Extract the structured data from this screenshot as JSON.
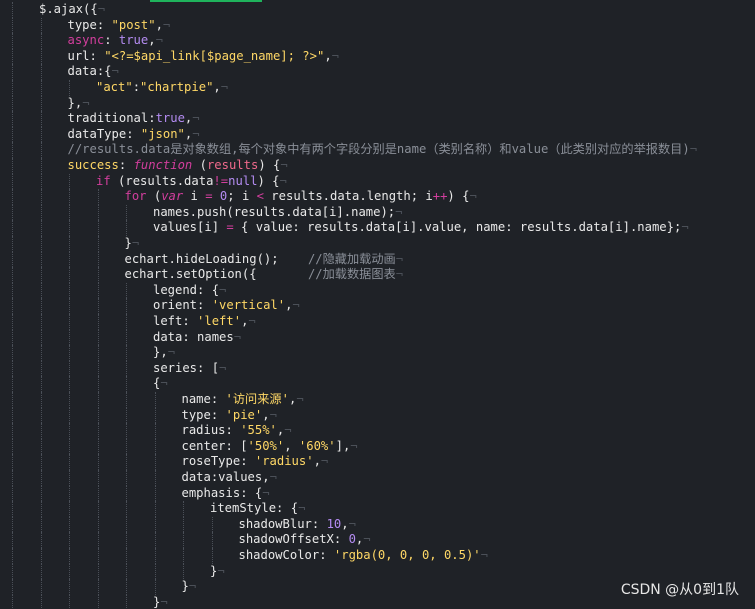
{
  "editor": {
    "lines": [
      {
        "indent": 0,
        "segments": [
          {
            "t": "$.ajax({",
            "c": "w"
          }
        ]
      },
      {
        "indent": 1,
        "segments": [
          {
            "t": "type: ",
            "c": "w"
          },
          {
            "t": "\"post\"",
            "c": "s"
          },
          {
            "t": ",",
            "c": "w"
          }
        ]
      },
      {
        "indent": 1,
        "segments": [
          {
            "t": "async",
            "c": "k"
          },
          {
            "t": ": ",
            "c": "w"
          },
          {
            "t": "true",
            "c": "n"
          },
          {
            "t": ",",
            "c": "w"
          }
        ]
      },
      {
        "indent": 1,
        "segments": [
          {
            "t": "url: ",
            "c": "w"
          },
          {
            "t": "\"<?=$api_link[$page_name]; ?>\"",
            "c": "s"
          },
          {
            "t": ",",
            "c": "w"
          }
        ]
      },
      {
        "indent": 1,
        "segments": [
          {
            "t": "data:{",
            "c": "w"
          }
        ]
      },
      {
        "indent": 2,
        "segments": [
          {
            "t": "\"act\"",
            "c": "s"
          },
          {
            "t": ":",
            "c": "w"
          },
          {
            "t": "\"chartpie\"",
            "c": "s"
          },
          {
            "t": ",",
            "c": "w"
          }
        ]
      },
      {
        "indent": 1,
        "segments": [
          {
            "t": "},",
            "c": "w"
          }
        ]
      },
      {
        "indent": 1,
        "segments": [
          {
            "t": "traditional:",
            "c": "w"
          },
          {
            "t": "true",
            "c": "n"
          },
          {
            "t": ",",
            "c": "w"
          }
        ]
      },
      {
        "indent": 1,
        "segments": [
          {
            "t": "dataType: ",
            "c": "w"
          },
          {
            "t": "\"json\"",
            "c": "s"
          },
          {
            "t": ",",
            "c": "w"
          }
        ]
      },
      {
        "indent": 1,
        "segments": [
          {
            "t": "//results.data是对象数组,每个对象中有两个字段分别是name（类别名称）和value（此类别对应的举报数目)",
            "c": "c"
          }
        ]
      },
      {
        "indent": 1,
        "segments": [
          {
            "t": "success",
            "c": "s"
          },
          {
            "t": ": ",
            "c": "w"
          },
          {
            "t": "function",
            "c": "ki"
          },
          {
            "t": " (",
            "c": "w"
          },
          {
            "t": "results",
            "c": "p"
          },
          {
            "t": ") {",
            "c": "w"
          }
        ]
      },
      {
        "indent": 2,
        "segments": [
          {
            "t": "if",
            "c": "k"
          },
          {
            "t": " (results.data",
            "c": "w"
          },
          {
            "t": "!=",
            "c": "k"
          },
          {
            "t": "null",
            "c": "n"
          },
          {
            "t": ") {",
            "c": "w"
          }
        ]
      },
      {
        "indent": 3,
        "segments": [
          {
            "t": "for",
            "c": "k"
          },
          {
            "t": " (",
            "c": "w"
          },
          {
            "t": "var",
            "c": "ki"
          },
          {
            "t": " i ",
            "c": "w"
          },
          {
            "t": "=",
            "c": "k"
          },
          {
            "t": " ",
            "c": "w"
          },
          {
            "t": "0",
            "c": "n"
          },
          {
            "t": "; i ",
            "c": "w"
          },
          {
            "t": "<",
            "c": "k"
          },
          {
            "t": " results.data.length; i",
            "c": "w"
          },
          {
            "t": "++",
            "c": "k"
          },
          {
            "t": ") {",
            "c": "w"
          }
        ]
      },
      {
        "indent": 4,
        "segments": [
          {
            "t": "names.push(results.data[i].name);",
            "c": "w"
          }
        ]
      },
      {
        "indent": 4,
        "segments": [
          {
            "t": "values[i] ",
            "c": "w"
          },
          {
            "t": "=",
            "c": "k"
          },
          {
            "t": " { value: results.data[i].value, name: results.data[i].name};",
            "c": "w"
          }
        ]
      },
      {
        "indent": 3,
        "segments": [
          {
            "t": "}",
            "c": "w"
          }
        ]
      },
      {
        "indent": 3,
        "segments": [
          {
            "t": "echart.hideLoading();    ",
            "c": "w"
          },
          {
            "t": "//隐藏加载动画",
            "c": "c"
          }
        ]
      },
      {
        "indent": 3,
        "segments": [
          {
            "t": "echart.setOption({       ",
            "c": "w"
          },
          {
            "t": "//加载数据图表",
            "c": "c"
          }
        ]
      },
      {
        "indent": 4,
        "segments": [
          {
            "t": "legend: {",
            "c": "w"
          }
        ]
      },
      {
        "indent": 4,
        "segments": [
          {
            "t": "orient: ",
            "c": "w"
          },
          {
            "t": "'vertical'",
            "c": "s"
          },
          {
            "t": ",",
            "c": "w"
          }
        ]
      },
      {
        "indent": 4,
        "segments": [
          {
            "t": "left: ",
            "c": "w"
          },
          {
            "t": "'left'",
            "c": "s"
          },
          {
            "t": ",",
            "c": "w"
          }
        ]
      },
      {
        "indent": 4,
        "segments": [
          {
            "t": "data: names",
            "c": "w"
          }
        ]
      },
      {
        "indent": 4,
        "segments": [
          {
            "t": "},",
            "c": "w"
          }
        ]
      },
      {
        "indent": 4,
        "segments": [
          {
            "t": "series: [",
            "c": "w"
          }
        ]
      },
      {
        "indent": 4,
        "segments": [
          {
            "t": "{",
            "c": "w"
          }
        ]
      },
      {
        "indent": 5,
        "segments": [
          {
            "t": "name: ",
            "c": "w"
          },
          {
            "t": "'访问来源'",
            "c": "s"
          },
          {
            "t": ",",
            "c": "w"
          }
        ]
      },
      {
        "indent": 5,
        "segments": [
          {
            "t": "type: ",
            "c": "w"
          },
          {
            "t": "'pie'",
            "c": "s"
          },
          {
            "t": ",",
            "c": "w"
          }
        ]
      },
      {
        "indent": 5,
        "segments": [
          {
            "t": "radius: ",
            "c": "w"
          },
          {
            "t": "'55%'",
            "c": "s"
          },
          {
            "t": ",",
            "c": "w"
          }
        ]
      },
      {
        "indent": 5,
        "segments": [
          {
            "t": "center: [",
            "c": "w"
          },
          {
            "t": "'50%'",
            "c": "s"
          },
          {
            "t": ", ",
            "c": "w"
          },
          {
            "t": "'60%'",
            "c": "s"
          },
          {
            "t": "],",
            "c": "w"
          }
        ]
      },
      {
        "indent": 5,
        "segments": [
          {
            "t": "roseType: ",
            "c": "w"
          },
          {
            "t": "'radius'",
            "c": "s"
          },
          {
            "t": ",",
            "c": "w"
          }
        ]
      },
      {
        "indent": 5,
        "segments": [
          {
            "t": "data:values,",
            "c": "w"
          }
        ]
      },
      {
        "indent": 5,
        "segments": [
          {
            "t": "emphasis: {",
            "c": "w"
          }
        ]
      },
      {
        "indent": 6,
        "segments": [
          {
            "t": "itemStyle: {",
            "c": "w"
          }
        ]
      },
      {
        "indent": 7,
        "segments": [
          {
            "t": "shadowBlur: ",
            "c": "w"
          },
          {
            "t": "10",
            "c": "n"
          },
          {
            "t": ",",
            "c": "w"
          }
        ]
      },
      {
        "indent": 7,
        "segments": [
          {
            "t": "shadowOffsetX: ",
            "c": "w"
          },
          {
            "t": "0",
            "c": "n"
          },
          {
            "t": ",",
            "c": "w"
          }
        ]
      },
      {
        "indent": 7,
        "segments": [
          {
            "t": "shadowColor: ",
            "c": "w"
          },
          {
            "t": "'rgba(0, 0, 0, 0.5)'",
            "c": "s"
          }
        ]
      },
      {
        "indent": 6,
        "segments": [
          {
            "t": "}",
            "c": "w"
          }
        ]
      },
      {
        "indent": 5,
        "segments": [
          {
            "t": "}",
            "c": "w"
          }
        ]
      },
      {
        "indent": 4,
        "segments": [
          {
            "t": "}",
            "c": "w"
          }
        ]
      }
    ]
  },
  "watermark": "CSDN @从0到1队",
  "colors": {
    "background": "#1f2227",
    "keyword": "#d23e9d",
    "string": "#ffd866",
    "number": "#b48cf2",
    "comment": "#8a8f98",
    "param": "#f06a8c",
    "accent": "#1fb35c"
  }
}
